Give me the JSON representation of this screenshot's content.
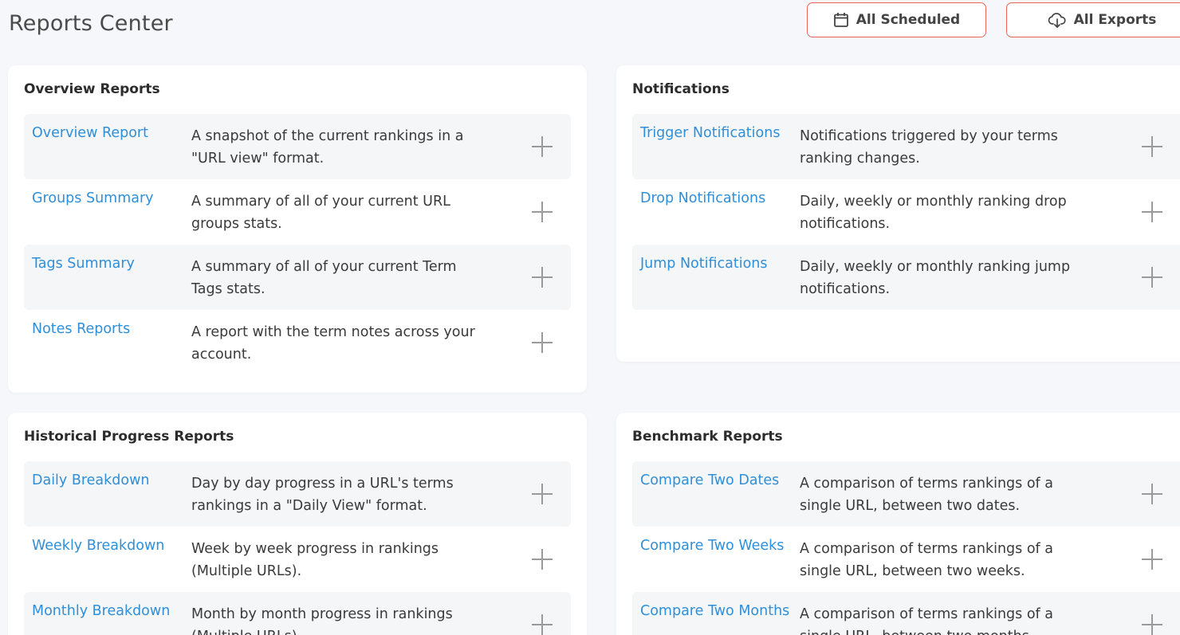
{
  "header": {
    "title": "Reports Center",
    "scheduled_label": "All Scheduled",
    "exports_label": "All Exports"
  },
  "overview": {
    "title": "Overview Reports",
    "items": [
      {
        "name": "Overview Report",
        "desc": "A snapshot of the current rankings in a \"URL view\" format."
      },
      {
        "name": "Groups Summary",
        "desc": "A summary of all of your current URL groups stats."
      },
      {
        "name": "Tags Summary",
        "desc": "A summary of all of your current Term Tags stats."
      },
      {
        "name": "Notes Reports",
        "desc": "A report with the term notes across your account."
      }
    ]
  },
  "notifications": {
    "title": "Notifications",
    "items": [
      {
        "name": "Trigger Notifications",
        "desc": "Notifications triggered by your terms ranking changes."
      },
      {
        "name": "Drop Notifications",
        "desc": "Daily, weekly or monthly ranking drop notifications."
      },
      {
        "name": "Jump Notifications",
        "desc": "Daily, weekly or monthly ranking jump notifications."
      }
    ]
  },
  "historical": {
    "title": "Historical Progress Reports",
    "items": [
      {
        "name": "Daily Breakdown",
        "desc": "Day by day progress in a URL's terms rankings in a \"Daily View\" format."
      },
      {
        "name": "Weekly Breakdown",
        "desc": "Week by week progress in rankings (Multiple URLs)."
      },
      {
        "name": "Monthly Breakdown",
        "desc": "Month by month progress in rankings (Multiple URLs)."
      }
    ]
  },
  "benchmark": {
    "title": "Benchmark Reports",
    "items": [
      {
        "name": "Compare Two Dates",
        "desc": "A comparison of terms rankings of a single URL, between two dates."
      },
      {
        "name": "Compare Two Weeks",
        "desc": "A comparison of terms rankings of a single URL, between two weeks."
      },
      {
        "name": "Compare Two Months",
        "desc": "A comparison of terms rankings of a single URL, between two months."
      }
    ]
  },
  "colors": {
    "accent_link": "#2f8fd9",
    "button_border": "#e8645a",
    "row_shade": "#f5f6f8",
    "page_bg": "#f6f7fb"
  },
  "icons": {
    "scheduled": "calendar-icon",
    "exports": "cloud-download-icon",
    "add": "plus-icon"
  }
}
